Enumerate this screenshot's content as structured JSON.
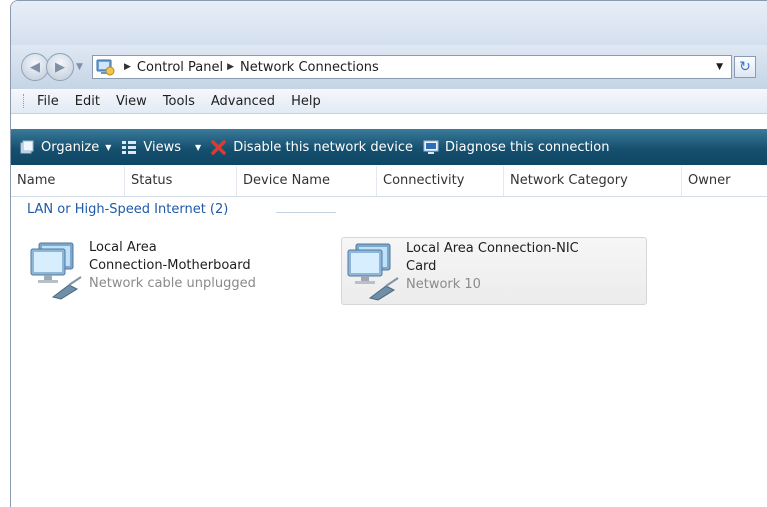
{
  "address": {
    "crumbs": [
      "Control Panel",
      "Network Connections"
    ]
  },
  "menu": [
    "File",
    "Edit",
    "View",
    "Tools",
    "Advanced",
    "Help"
  ],
  "toolbar": {
    "organize": "Organize",
    "views": "Views",
    "disable": "Disable this network device",
    "diagnose": "Diagnose this connection"
  },
  "columns": [
    "Name",
    "Status",
    "Device Name",
    "Connectivity",
    "Network Category",
    "Owner"
  ],
  "group": {
    "label": "LAN or High-Speed Internet (2)"
  },
  "connections": [
    {
      "name_line1": "Local Area",
      "name_line2": "Connection-Motherboard",
      "status": "Network cable unplugged"
    },
    {
      "name_line1": "Local Area Connection-NIC",
      "name_line2": "Card",
      "status": "Network 10"
    }
  ],
  "icons": {
    "nav_back": "arrow-left-icon",
    "nav_forward": "arrow-right-icon",
    "control_panel": "control-panel-icon",
    "refresh": "refresh-icon",
    "organize": "organize-icon",
    "views": "views-icon",
    "disable": "disable-x-icon",
    "diagnose": "diagnose-icon",
    "network": "network-computer-icon"
  },
  "colors": {
    "toolbar": "#16506f",
    "group_header": "#1e5aa8",
    "disable_x": "#e03a2e"
  }
}
